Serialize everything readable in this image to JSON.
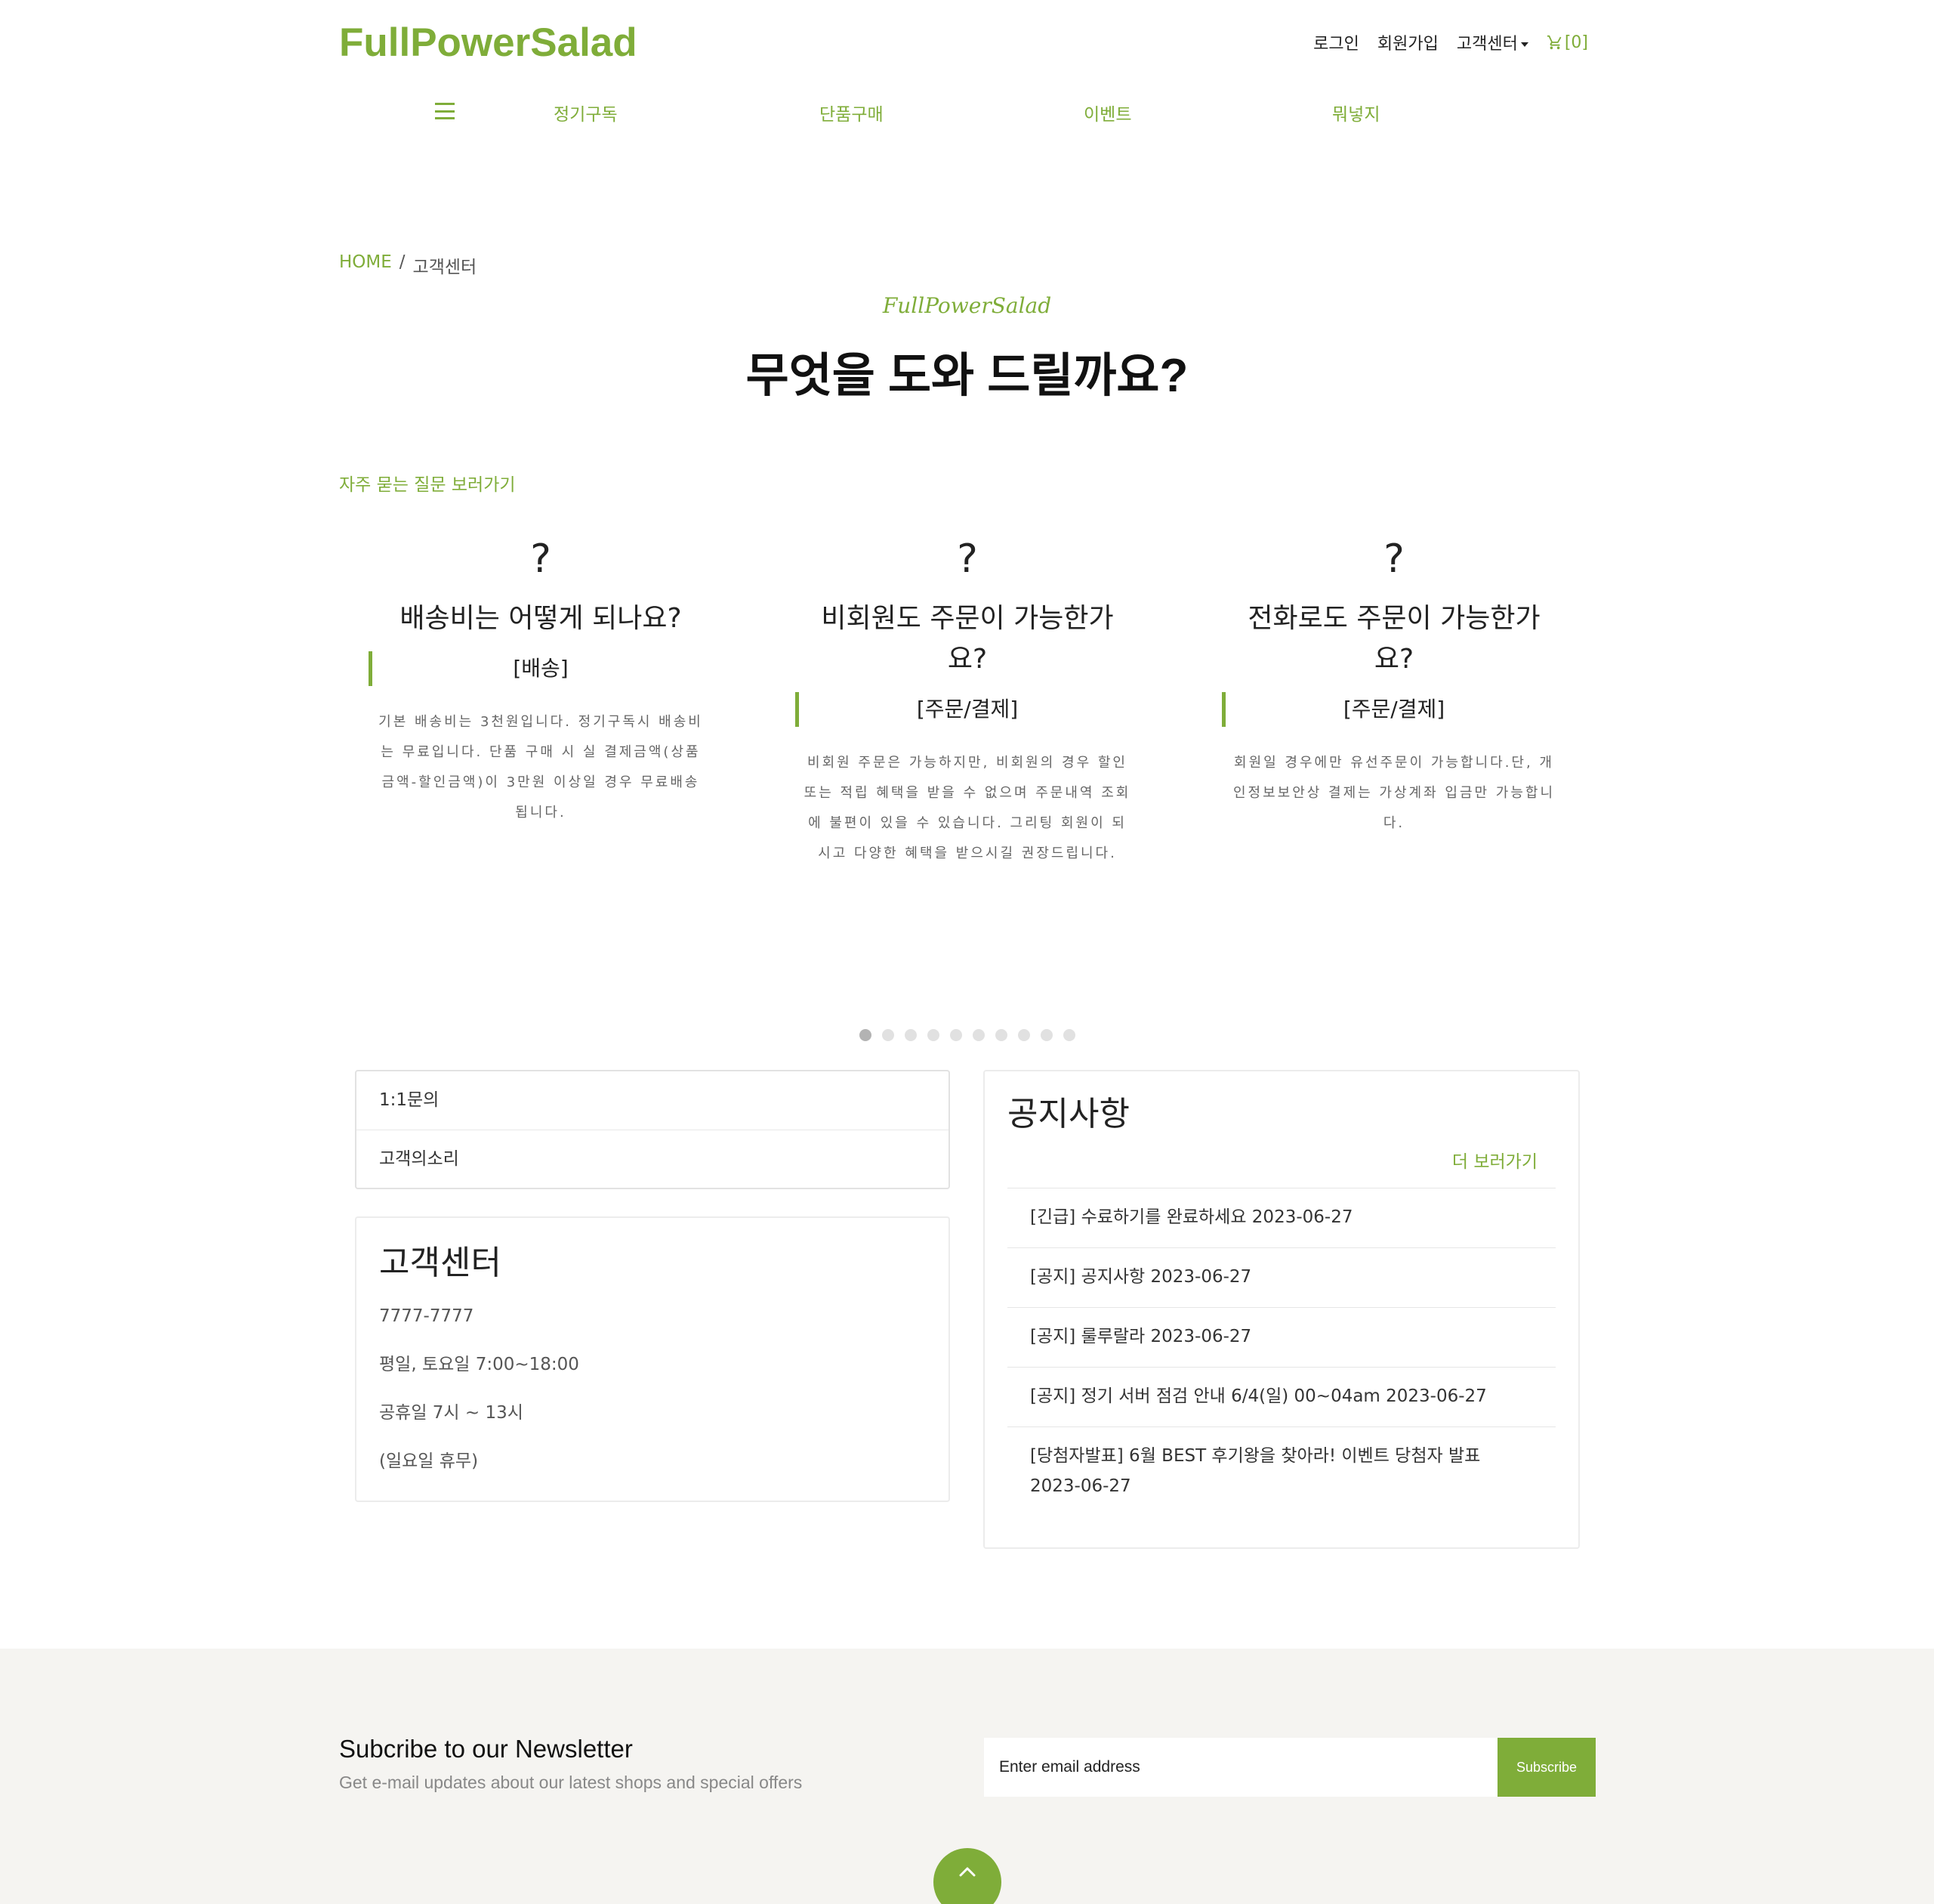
{
  "header": {
    "logo": "FullPowerSalad",
    "top_links": {
      "login": "로그인",
      "signup": "회원가입",
      "support": "고객센터",
      "cart": "[0]"
    },
    "nav": [
      "정기구독",
      "단품구매",
      "이벤트",
      "뭐넣지"
    ],
    "icons": {
      "menu": "hamburger-icon",
      "cart": "cart-icon",
      "dropdown": "caret-down-icon"
    }
  },
  "breadcrumb": {
    "home": "HOME",
    "separator": "/",
    "current": "고객센터"
  },
  "hero": {
    "brand": "FullPowerSalad",
    "title": "무엇을 도와 드릴까요?"
  },
  "faq": {
    "link": "자주 묻는 질문 보러가기",
    "items": [
      {
        "q": "?",
        "title": "배송비는 어떻게 되나요?",
        "category": "[배송]",
        "body": "기본 배송비는 3천원입니다. 정기구독시 배송비는 무료입니다. 단품 구매 시 실 결제금액(상품금액-할인금액)이 3만원 이상일 경우 무료배송됩니다."
      },
      {
        "q": "?",
        "title": "비회원도 주문이 가능한가요?",
        "category": "[주문/결제]",
        "body": "비회원 주문은 가능하지만, 비회원의 경우 할인 또는 적립 혜택을 받을 수 없으며 주문내역 조회에 불편이 있을 수 있습니다. 그리팅 회원이 되시고 다양한 혜택을 받으시길 권장드립니다."
      },
      {
        "q": "?",
        "title": "전화로도 주문이 가능한가요?",
        "category": "[주문/결제]",
        "body": "회원일 경우에만 유선주문이 가능합니다.단, 개인정보보안상 결제는 가상계좌 입금만 가능합니다."
      }
    ],
    "pagination": {
      "count": 10,
      "active": 1
    }
  },
  "inquiry": {
    "items": [
      "1:1문의",
      "고객의소리"
    ]
  },
  "customer_center": {
    "title": "고객센터",
    "phone": "7777-7777",
    "hours_weekday": "평일, 토요일 7:00~18:00",
    "hours_holiday": "공휴일 7시 ~ 13시",
    "closed": "(일요일 휴무)"
  },
  "notice": {
    "title": "공지사항",
    "more": "더 보러가기",
    "items": [
      "[긴급] 수료하기를 완료하세요 2023-06-27",
      "[공지] 공지사항 2023-06-27",
      "[공지] 룰루랄라 2023-06-27",
      "[공지] 정기 서버 점검 안내 6/4(일) 00~04am 2023-06-27",
      "[당첨자발표] 6월 BEST 후기왕을 찾아라! 이벤트 당첨자 발표 2023-06-27"
    ]
  },
  "newsletter": {
    "title": "Subcribe to our Newsletter",
    "subtitle": "Get e-mail updates about our latest shops and special offers",
    "placeholder": "Enter email address",
    "button": "Subscribe"
  },
  "scroll_top_icon": "chevron-up-icon",
  "colors": {
    "accent": "#7fad39",
    "footer_bg": "#f5f4f1"
  }
}
